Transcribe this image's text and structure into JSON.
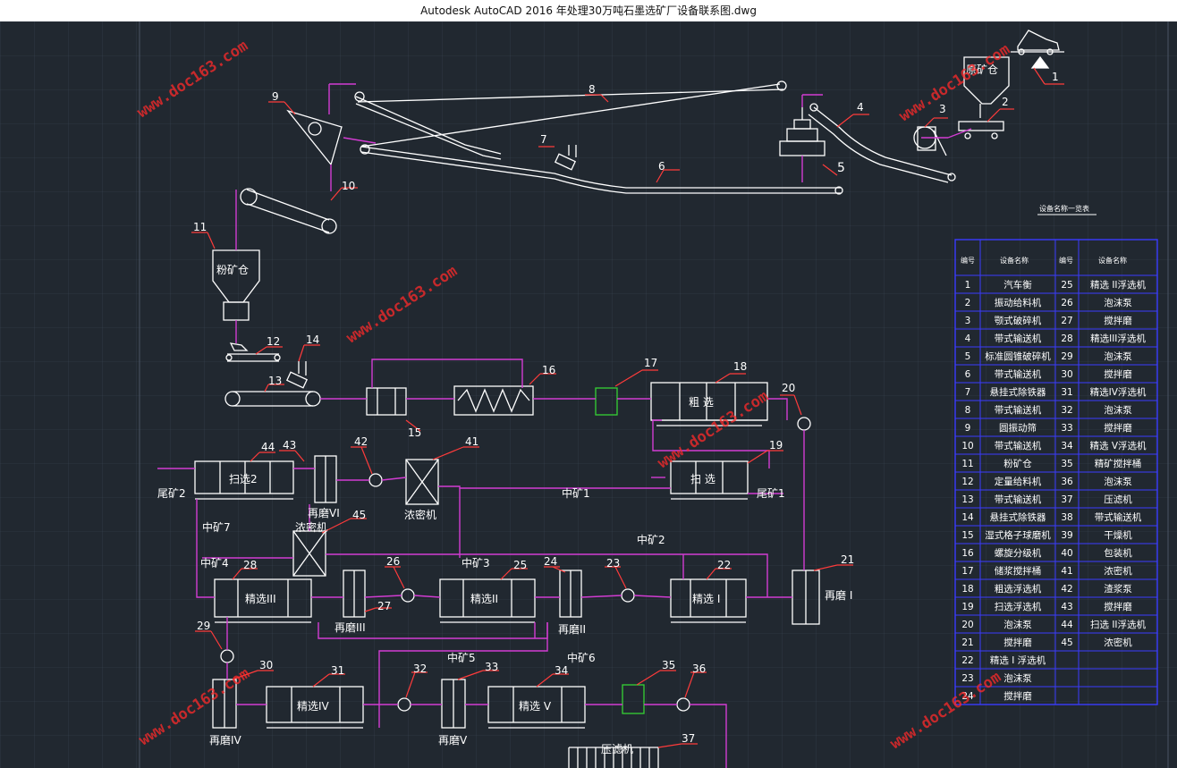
{
  "window": {
    "title": "Autodesk AutoCAD 2016     年处理30万吨石墨选矿厂设备联系图.dwg"
  },
  "watermark": {
    "text": "www.doc163.com"
  },
  "colors": {
    "background": "#212830",
    "line": "#ffffff",
    "flow": "#d23cd2",
    "callout": "#ff3b3b",
    "table_border": "#3b3bff",
    "green": "#35d135",
    "grid": "#3a4452"
  },
  "labels": {
    "n1": "1",
    "n2": "2",
    "n3": "3",
    "n4": "4",
    "n5": "5",
    "n6": "6",
    "n7": "7",
    "n8": "8",
    "n9": "9",
    "n10": "10",
    "n11": "11",
    "n12": "12",
    "n13": "13",
    "n14": "14",
    "n15": "15",
    "n16": "16",
    "n17": "17",
    "n18": "18",
    "n19": "19",
    "n20": "20",
    "n21": "21",
    "n22": "22",
    "n23": "23",
    "n24": "24",
    "n25": "25",
    "n26": "26",
    "n27": "27",
    "n28": "28",
    "n29": "29",
    "n30": "30",
    "n31": "31",
    "n32": "32",
    "n33": "33",
    "n34": "34",
    "n35": "35",
    "n36": "36",
    "n37": "37",
    "n41": "41",
    "n42": "42",
    "n43": "43",
    "n44": "44",
    "n45": "45",
    "yuankucang": "原矿仓",
    "fenkuangcang": "粉矿仓",
    "cuxuan": "粗  选",
    "saoxuan": "扫  选",
    "saoxuan2": "扫选2",
    "jingxuan1": "精选 I",
    "jingxuan2": "精选II",
    "jingxuan3": "精选III",
    "jingxuan4": "精选IV",
    "jingxuan5": "精选 V",
    "zaimo1": "再磨 I",
    "zaimo2": "再磨II",
    "zaimo3": "再磨III",
    "zaimo4": "再磨IV",
    "zaimo5": "再磨V",
    "zaimo6": "再磨VI",
    "nongmiji": "浓密机",
    "nongmiji2": "浓密机",
    "yalvji": "压滤机",
    "weikuang1": "尾矿1",
    "weikuang2": "尾矿2",
    "zk1": "中矿1",
    "zk2": "中矿2",
    "zk3": "中矿3",
    "zk4": "中矿4",
    "zk5": "中矿5",
    "zk6": "中矿6",
    "zk7": "中矿7"
  },
  "table": {
    "caption": "设备名称一览表",
    "headers": [
      "编号",
      "设备名称",
      "编号",
      "设备名称"
    ],
    "rows": [
      [
        "1",
        "汽车衡",
        "25",
        "精选 II浮选机"
      ],
      [
        "2",
        "振动给料机",
        "26",
        "泡沫泵"
      ],
      [
        "3",
        "颚式破碎机",
        "27",
        "搅拌磨"
      ],
      [
        "4",
        "带式输送机",
        "28",
        "精选III浮选机"
      ],
      [
        "5",
        "标准圆锥破碎机",
        "29",
        "泡沫泵"
      ],
      [
        "6",
        "带式输送机",
        "30",
        "搅拌磨"
      ],
      [
        "7",
        "悬挂式除铁器",
        "31",
        "精选IV浮选机"
      ],
      [
        "8",
        "带式输送机",
        "32",
        "泡沫泵"
      ],
      [
        "9",
        "圆振动筛",
        "33",
        "搅拌磨"
      ],
      [
        "10",
        "带式输送机",
        "34",
        "精选 V浮选机"
      ],
      [
        "11",
        "粉矿仓",
        "35",
        "精矿搅拌桶"
      ],
      [
        "12",
        "定量给料机",
        "36",
        "泡沫泵"
      ],
      [
        "13",
        "带式输送机",
        "37",
        "压滤机"
      ],
      [
        "14",
        "悬挂式除铁器",
        "38",
        "带式输送机"
      ],
      [
        "15",
        "湿式格子球磨机",
        "39",
        "干燥机"
      ],
      [
        "16",
        "螺旋分级机",
        "40",
        "包装机"
      ],
      [
        "17",
        "储浆搅拌桶",
        "41",
        "浓密机"
      ],
      [
        "18",
        "粗选浮选机",
        "42",
        "渣浆泵"
      ],
      [
        "19",
        "扫选浮选机",
        "43",
        "搅拌磨"
      ],
      [
        "20",
        "泡沫泵",
        "44",
        "扫选 II浮选机"
      ],
      [
        "21",
        "搅拌磨",
        "45",
        "浓密机"
      ],
      [
        "22",
        "精选 I 浮选机",
        "",
        ""
      ],
      [
        "23",
        "泡沫泵",
        "",
        ""
      ],
      [
        "24",
        "搅拌磨",
        "",
        ""
      ]
    ]
  }
}
